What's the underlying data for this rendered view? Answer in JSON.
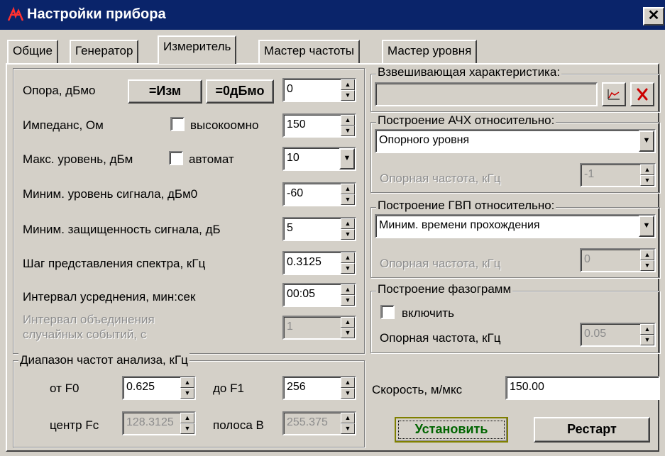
{
  "window": {
    "title": "Настройки прибора",
    "close_glyph": "✕"
  },
  "tabs": [
    {
      "label": "Общие"
    },
    {
      "label": "Генератор"
    },
    {
      "label": "Измеритель"
    },
    {
      "label": "Мастер частоты"
    },
    {
      "label": "Мастер уровня"
    }
  ],
  "left": {
    "ref_label": "Опора, дБмо",
    "btn_meas": "=Изм",
    "btn_zero": "=0дБмо",
    "ref_value": "0",
    "impedance_label": "Импеданс, Ом",
    "high_imp_label": "высокоомно",
    "impedance_value": "150",
    "max_level_label": "Макс. уровень, дБм",
    "auto_label": "автомат",
    "max_level_value": "10",
    "min_signal_label": "Миним. уровень сигнала, дБм0",
    "min_signal_value": "-60",
    "min_snr_label": "Миним. защищенность сигнала, дБ",
    "min_snr_value": "5",
    "spectrum_step_label": "Шаг представления спектра, кГц",
    "spectrum_step_value": "0.3125",
    "avg_interval_label": "Интервал усреднения, мин:сек",
    "avg_interval_value": "00:05",
    "merge_interval_label_1": "Интервал объединения",
    "merge_interval_label_2": "случайных событий, с",
    "merge_interval_value": "1"
  },
  "range": {
    "title": "Диапазон частот анализа, кГц",
    "f0_label": "от F0",
    "f0_value": "0.625",
    "f1_label": "до F1",
    "f1_value": "256",
    "fc_label": "центр Fc",
    "fc_value": "128.3125",
    "band_label": "полоса B",
    "band_value": "255.375"
  },
  "weighting": {
    "title": "Взвешивающая характеристика:",
    "value": ""
  },
  "afc": {
    "title": "Построение АЧХ относительно:",
    "selected": "Опорного уровня",
    "ref_freq_label": "Опорная частота, кГц",
    "ref_freq_value": "-1"
  },
  "gvp": {
    "title": "Построение ГВП относительно:",
    "selected": "Миним. времени прохождения",
    "ref_freq_label": "Опорная частота, кГц",
    "ref_freq_value": "0"
  },
  "phase": {
    "title": "Построение фазограмм",
    "enable_label": "включить",
    "ref_freq_label": "Опорная частота, кГц",
    "ref_freq_value": "0.05"
  },
  "speed": {
    "label": "Скорость, м/мкс",
    "value": "150.00"
  },
  "buttons": {
    "apply": "Установить",
    "restart": "Рестарт"
  },
  "colors": {
    "title_bar": "#0a246a",
    "face": "#d4d0c8",
    "apply_text": "#006400",
    "apply_frame": "#808000",
    "red_x": "#cc0000"
  }
}
